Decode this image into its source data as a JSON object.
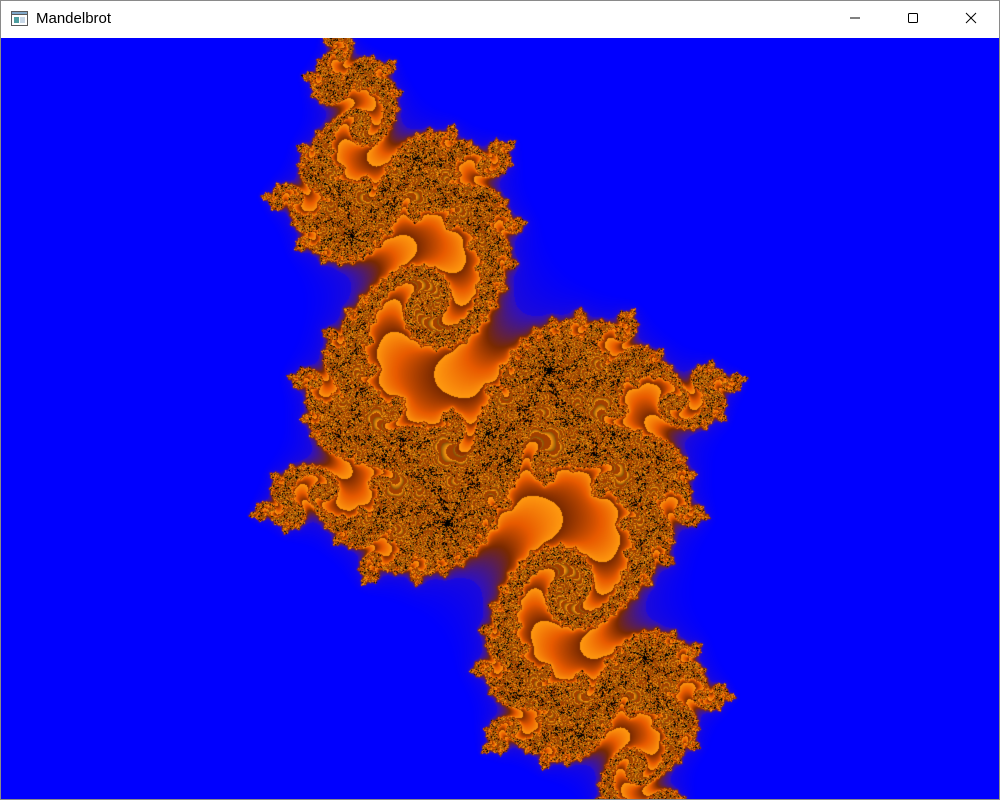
{
  "window": {
    "title": "Mandelbrot",
    "icon": "app-window-icon",
    "controls": {
      "minimize_icon": "minimize-icon",
      "maximize_icon": "maximize-icon",
      "close_icon": "close-icon"
    }
  },
  "fractal": {
    "background_color": "#0000ff",
    "colors": {
      "set": "#000000",
      "inner": "#7a2a00",
      "mid": "#e85a00",
      "outer": "#ff9a10",
      "halo": "#3010c0"
    }
  }
}
